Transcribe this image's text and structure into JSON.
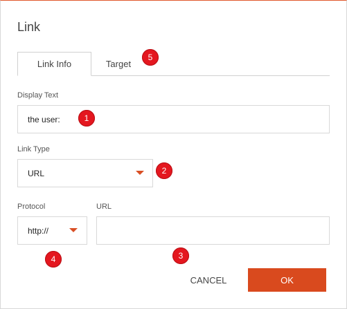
{
  "dialog": {
    "title": "Link"
  },
  "tabs": [
    {
      "label": "Link Info",
      "active": true
    },
    {
      "label": "Target",
      "active": false
    }
  ],
  "fields": {
    "display_text": {
      "label": "Display Text",
      "value": "the user:"
    },
    "link_type": {
      "label": "Link Type",
      "value": "URL"
    },
    "protocol": {
      "label": "Protocol",
      "value": "http://"
    },
    "url": {
      "label": "URL",
      "value": ""
    }
  },
  "buttons": {
    "cancel": "CANCEL",
    "ok": "OK"
  },
  "markers": [
    "1",
    "2",
    "3",
    "4",
    "5"
  ],
  "colors": {
    "accent": "#d94a1e",
    "marker": "#e4171f"
  }
}
